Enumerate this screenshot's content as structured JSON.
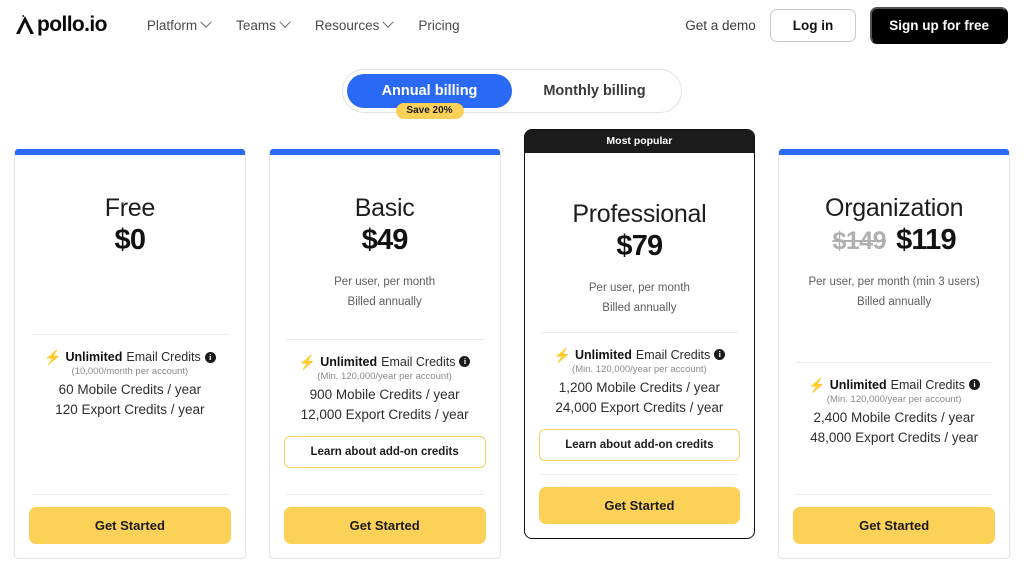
{
  "nav": {
    "logo_text": "pollo.io",
    "logo_icon": "apollo-logo-icon",
    "links": [
      {
        "label": "Platform",
        "has_caret": true
      },
      {
        "label": "Teams",
        "has_caret": true
      },
      {
        "label": "Resources",
        "has_caret": true
      },
      {
        "label": "Pricing",
        "has_caret": false
      }
    ],
    "demo_label": "Get a demo",
    "login_label": "Log in",
    "signup_label": "Sign up for free"
  },
  "billing_toggle": {
    "annual_label": "Annual billing",
    "monthly_label": "Monthly billing",
    "save_badge": "Save 20%",
    "selected": "Annual billing",
    "active_color": "#2a69f4",
    "badge_color": "#fbd158"
  },
  "plans": [
    {
      "name": "Free",
      "price": "$0",
      "old_price": "",
      "per_user": "",
      "billed": "",
      "ribbon": "",
      "accent_color": "#2a69f4",
      "email_credits_bold": "Unlimited",
      "email_credits_rest": "Email Credits",
      "email_credits_note": "(10,000/month per account)",
      "mobile_credits": "60 Mobile Credits / year",
      "export_credits": "120 Export Credits / year",
      "addon_label": "",
      "cta_label": "Get Started"
    },
    {
      "name": "Basic",
      "price": "$49",
      "old_price": "",
      "per_user": "Per user, per month",
      "billed": "Billed annually",
      "ribbon": "",
      "accent_color": "#2a69f4",
      "email_credits_bold": "Unlimited",
      "email_credits_rest": "Email Credits",
      "email_credits_note": "(Min. 120,000/year per account)",
      "mobile_credits": "900 Mobile Credits / year",
      "export_credits": "12,000 Export Credits / year",
      "addon_label": "Learn about add-on credits",
      "cta_label": "Get Started"
    },
    {
      "name": "Professional",
      "price": "$79",
      "old_price": "",
      "per_user": "Per user, per month",
      "billed": "Billed annually",
      "ribbon": "Most popular",
      "accent_color": "#1b1b1b",
      "email_credits_bold": "Unlimited",
      "email_credits_rest": "Email Credits",
      "email_credits_note": "(Min. 120,000/year per account)",
      "mobile_credits": "1,200 Mobile Credits / year",
      "export_credits": "24,000 Export Credits / year",
      "addon_label": "Learn about add-on credits",
      "cta_label": "Get Started"
    },
    {
      "name": "Organization",
      "price": "$119",
      "old_price": "$149",
      "per_user": "Per user, per month (min 3 users)",
      "billed": "Billed annually",
      "ribbon": "",
      "accent_color": "#2a69f4",
      "email_credits_bold": "Unlimited",
      "email_credits_rest": "Email Credits",
      "email_credits_note": "(Min. 120,000/year per account)",
      "mobile_credits": "2,400 Mobile Credits / year",
      "export_credits": "48,000 Export Credits / year",
      "addon_label": "",
      "cta_label": "Get Started"
    }
  ],
  "icons": {
    "bolt": "⚡",
    "info": "i"
  }
}
